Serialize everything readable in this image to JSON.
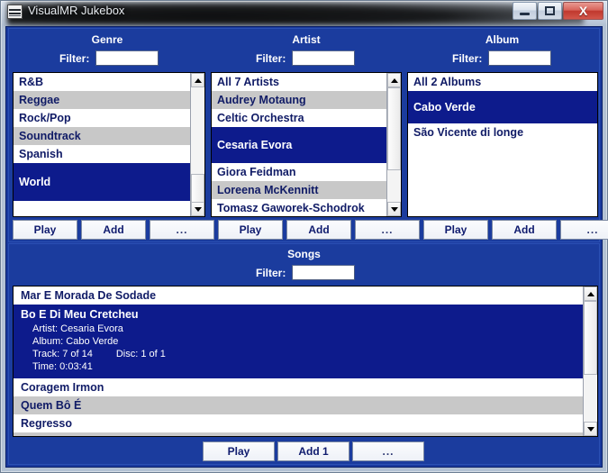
{
  "window": {
    "title": "VisualMR Jukebox",
    "icon": "app-icon",
    "buttons": {
      "minimize": "minimize",
      "maximize": "maximize",
      "close": "X"
    }
  },
  "colors": {
    "panel_blue": "#1b3c9e",
    "selection_blue": "#0d1b8c",
    "row_alt_gray": "#c8c8c8",
    "text_blue": "#101b66",
    "close_red": "#c0382e"
  },
  "panels": [
    {
      "id": "genre",
      "header": "Genre",
      "filter_label": "Filter:",
      "filter_value": "",
      "filter_placeholder": "",
      "items": [
        {
          "label": "R&B",
          "selected": false
        },
        {
          "label": "Reggae",
          "selected": false
        },
        {
          "label": "Rock/Pop",
          "selected": false
        },
        {
          "label": "Soundtrack",
          "selected": false
        },
        {
          "label": "Spanish",
          "selected": false
        },
        {
          "label": "World",
          "selected": true
        }
      ],
      "buttons": [
        "Play",
        "Add",
        "..."
      ]
    },
    {
      "id": "artist",
      "header": "Artist",
      "filter_label": "Filter:",
      "filter_value": "",
      "filter_placeholder": "",
      "items": [
        {
          "label": "All 7 Artists",
          "selected": false
        },
        {
          "label": "Audrey Motaung",
          "selected": false
        },
        {
          "label": "Celtic Orchestra",
          "selected": false
        },
        {
          "label": "Cesaria Evora",
          "selected": true
        },
        {
          "label": "Giora Feidman",
          "selected": false
        },
        {
          "label": "Loreena McKennitt",
          "selected": false
        },
        {
          "label": "Tomasz Gaworek-Schodrok",
          "selected": false
        }
      ],
      "buttons": [
        "Play",
        "Add",
        "..."
      ]
    },
    {
      "id": "album",
      "header": "Album",
      "filter_label": "Filter:",
      "filter_value": "",
      "filter_placeholder": "",
      "items": [
        {
          "label": "All 2 Albums",
          "selected": false
        },
        {
          "label": "Cabo Verde",
          "selected": true
        },
        {
          "label": "São Vicente di longe",
          "selected": false
        }
      ],
      "buttons": [
        "Play",
        "Add",
        "..."
      ]
    }
  ],
  "songs": {
    "header": "Songs",
    "filter_label": "Filter:",
    "filter_value": "",
    "filter_placeholder": "",
    "items": [
      {
        "label": "Mar E Morada De Sodade",
        "selected": false
      },
      {
        "label": "Bo E Di Meu Cretcheu",
        "selected": true,
        "details": {
          "artist": "Artist: Cesaria Evora",
          "album": "Album: Cabo Verde",
          "track": "Track: 7 of 14",
          "disc": "Disc: 1 of 1",
          "time": "Time: 0:03:41"
        }
      },
      {
        "label": "Coragem Irmon",
        "selected": false
      },
      {
        "label": "Quem Bô É",
        "selected": false
      },
      {
        "label": "Regresso",
        "selected": false
      },
      {
        "label": "",
        "selected": false
      }
    ],
    "buttons": [
      "Play",
      "Add 1",
      "..."
    ]
  }
}
